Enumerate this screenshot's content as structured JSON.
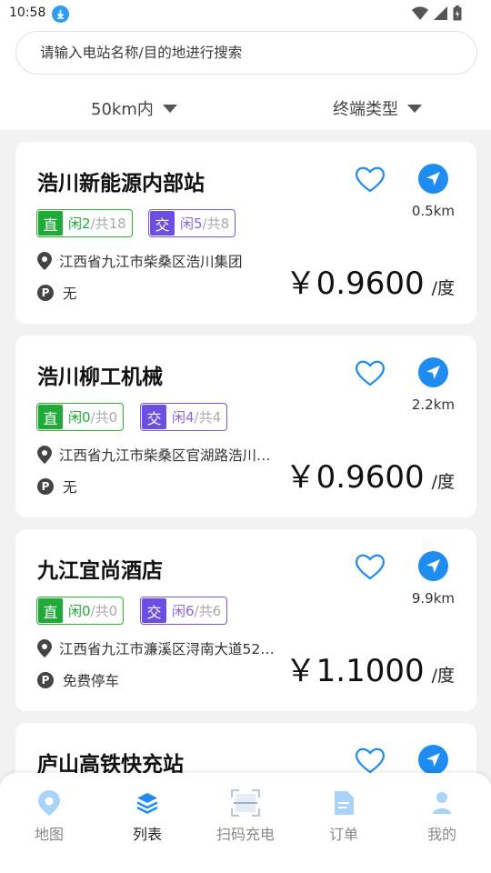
{
  "status_bar": {
    "time": "10:58"
  },
  "search": {
    "placeholder": "请输入电站名称/目的地进行搜索"
  },
  "filters": {
    "distance": "50km内",
    "terminal_type": "终端类型"
  },
  "stations": [
    {
      "name": "浩川新能源内部站",
      "distance": "0.5km",
      "dc_label": "直",
      "dc_idle": "闲2",
      "dc_total": "共18",
      "ac_label": "交",
      "ac_idle": "闲5",
      "ac_total": "共8",
      "address": "江西省九江市柴桑区浩川集团",
      "parking": "无",
      "price": "￥0.9600",
      "unit": "/度"
    },
    {
      "name": "浩川柳工机械",
      "distance": "2.2km",
      "dc_label": "直",
      "dc_idle": "闲0",
      "dc_total": "共0",
      "ac_label": "交",
      "ac_idle": "闲4",
      "ac_total": "共4",
      "address": "江西省九江市柴桑区官湖路浩川…",
      "parking": "无",
      "price": "￥0.9600",
      "unit": "/度"
    },
    {
      "name": "九江宜尚酒店",
      "distance": "9.9km",
      "dc_label": "直",
      "dc_idle": "闲0",
      "dc_total": "共0",
      "ac_label": "交",
      "ac_idle": "闲6",
      "ac_total": "共6",
      "address": "江西省九江市濂溪区浔南大道52…",
      "parking": "免费停车",
      "price": "￥1.1000",
      "unit": "/度"
    },
    {
      "name": "庐山高铁快充站"
    }
  ],
  "tabs": [
    {
      "label": "地图",
      "icon": "map-pin-icon"
    },
    {
      "label": "列表",
      "icon": "layers-icon",
      "active": true
    },
    {
      "label": "扫码充电",
      "icon": "scan-icon"
    },
    {
      "label": "订单",
      "icon": "document-icon"
    },
    {
      "label": "我的",
      "icon": "user-icon"
    }
  ],
  "colors": {
    "accent": "#1e8cf0",
    "dc_green": "#21a93a",
    "ac_purple": "#6c4fe0"
  }
}
